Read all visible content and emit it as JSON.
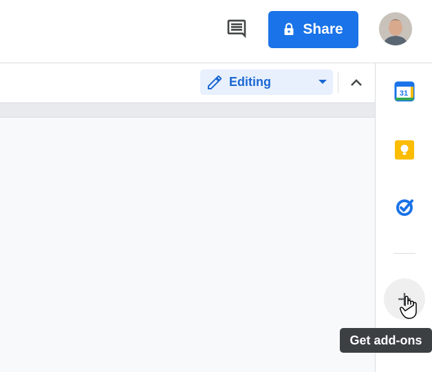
{
  "header": {
    "share_label": "Share",
    "icons": [
      "comment-icon",
      "lock-icon",
      "avatar"
    ]
  },
  "toolbar": {
    "mode_label": "Editing",
    "icons": [
      "pencil-icon",
      "caret-down-icon",
      "chevron-up-icon"
    ]
  },
  "side_panel": {
    "calendar_day": "31",
    "items": [
      "calendar-icon",
      "keep-icon",
      "tasks-icon",
      "plus-icon"
    ],
    "tooltip": "Get add-ons"
  },
  "colors": {
    "accent": "#1a73e8",
    "mode_bg": "#e8f0fe",
    "tooltip_bg": "#3c4043",
    "keep_yellow": "#fbbc04",
    "calendar_blue": "#1a73e8"
  }
}
